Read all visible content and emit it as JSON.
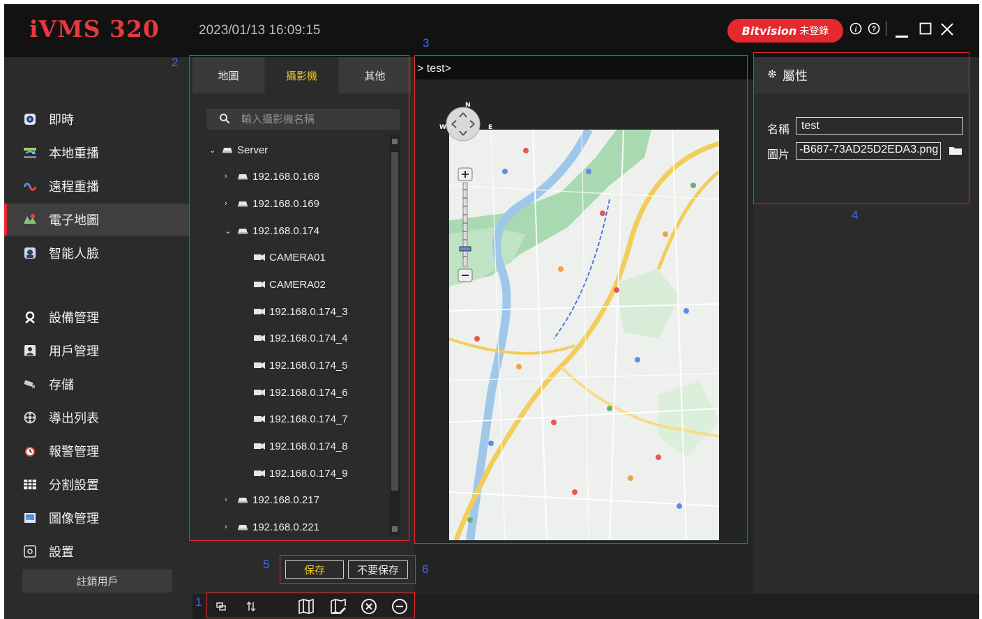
{
  "app": {
    "logo": "iVMS 320",
    "datetime": "2023/01/13 16:09:15",
    "brand_name": "Bitvision",
    "login_status": "未登錄",
    "accent_color": "#e5292f",
    "highlight_color": "#e9c21f"
  },
  "window_controls": [
    "info-icon",
    "help-icon",
    "minimize-icon",
    "maximize-icon",
    "close-icon"
  ],
  "sidebar": {
    "items": [
      {
        "label": "即時",
        "icon": "live-icon"
      },
      {
        "label": "本地重播",
        "icon": "local-playback-icon"
      },
      {
        "label": "遠程重播",
        "icon": "remote-playback-icon"
      },
      {
        "label": "電子地圖",
        "icon": "emap-icon",
        "active": true
      },
      {
        "label": "智能人臉",
        "icon": "face-icon"
      },
      {
        "label": "設備管理",
        "icon": "device-icon"
      },
      {
        "label": "用戶管理",
        "icon": "user-icon"
      },
      {
        "label": "存儲",
        "icon": "storage-icon"
      },
      {
        "label": "導出列表",
        "icon": "export-icon"
      },
      {
        "label": "報警管理",
        "icon": "alarm-icon"
      },
      {
        "label": "分割設置",
        "icon": "split-icon"
      },
      {
        "label": "圖像管理",
        "icon": "image-icon"
      },
      {
        "label": "設置",
        "icon": "settings-icon"
      }
    ],
    "logout": "註銷用戶"
  },
  "tree_panel": {
    "tabs": [
      {
        "label": "地圖"
      },
      {
        "label": "攝影機",
        "active": true
      },
      {
        "label": "其他"
      }
    ],
    "search_placeholder": "輸入攝影機名稱",
    "root": "Server",
    "servers": [
      "192.168.0.168",
      "192.168.0.169",
      "192.168.0.174"
    ],
    "cameras": [
      "CAMERA01",
      "CAMERA02",
      "192.168.0.174_3",
      "192.168.0.174_4",
      "192.168.0.174_5",
      "192.168.0.174_6",
      "192.168.0.174_7",
      "192.168.0.174_8",
      "192.168.0.174_9"
    ],
    "servers_after": [
      "192.168.0.217",
      "192.168.0.221"
    ]
  },
  "map_panel": {
    "breadcrumb": "> test>",
    "compass": {
      "n": "N",
      "w": "W",
      "e": "E"
    }
  },
  "properties": {
    "title": "屬性",
    "name_label": "名稱",
    "name_value": "test",
    "image_label": "圖片",
    "image_value": "-B687-73AD25D2EDA3.png"
  },
  "actions": {
    "save": "保存",
    "discard": "不要保存"
  },
  "annotations": [
    "1",
    "2",
    "3",
    "4",
    "5",
    "6"
  ]
}
